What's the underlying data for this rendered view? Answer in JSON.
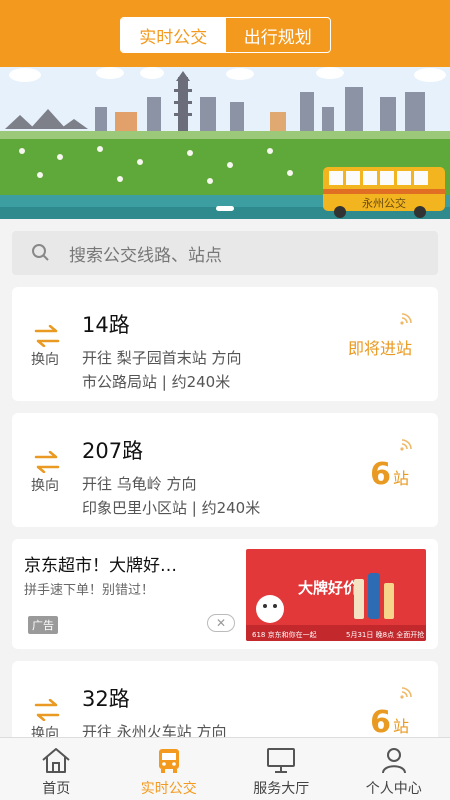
{
  "header": {
    "tabs": [
      {
        "label": "实时公交",
        "active": true
      },
      {
        "label": "出行规划",
        "active": false
      }
    ]
  },
  "banner": {
    "bus_text": "永州公交"
  },
  "search": {
    "placeholder": "搜索公交线路、站点"
  },
  "cards": [
    {
      "route": "14路",
      "swap_label": "换向",
      "direction": "开往 梨子园首末站 方向",
      "stop": "市公路局站 | 约240米",
      "status": "即将进站"
    },
    {
      "route": "207路",
      "swap_label": "换向",
      "direction": "开往 乌龟岭 方向",
      "stop": "印象巴里小区站 | 约240米",
      "count": "6",
      "unit": "站"
    },
    {
      "route": "32路",
      "swap_label": "换向",
      "direction": "开往 永州火车站 方向",
      "count": "6",
      "unit": "站"
    }
  ],
  "ad": {
    "title": "京东超市！大牌好…",
    "subtitle": "拼手速下单！别错过！",
    "tag": "广告",
    "close": "✕",
    "image": {
      "headline": "大牌好价",
      "footer_left": "618 京东和你在一起",
      "footer_right": "5月31日 晚8点 全面开抢"
    }
  },
  "tabbar": [
    {
      "label": "首页",
      "icon": "home-icon",
      "active": false
    },
    {
      "label": "实时公交",
      "icon": "bus-icon",
      "active": true
    },
    {
      "label": "服务大厅",
      "icon": "monitor-icon",
      "active": false
    },
    {
      "label": "个人中心",
      "icon": "person-icon",
      "active": false
    }
  ],
  "colors": {
    "accent": "#f39a1e",
    "status": "#e99a22"
  }
}
